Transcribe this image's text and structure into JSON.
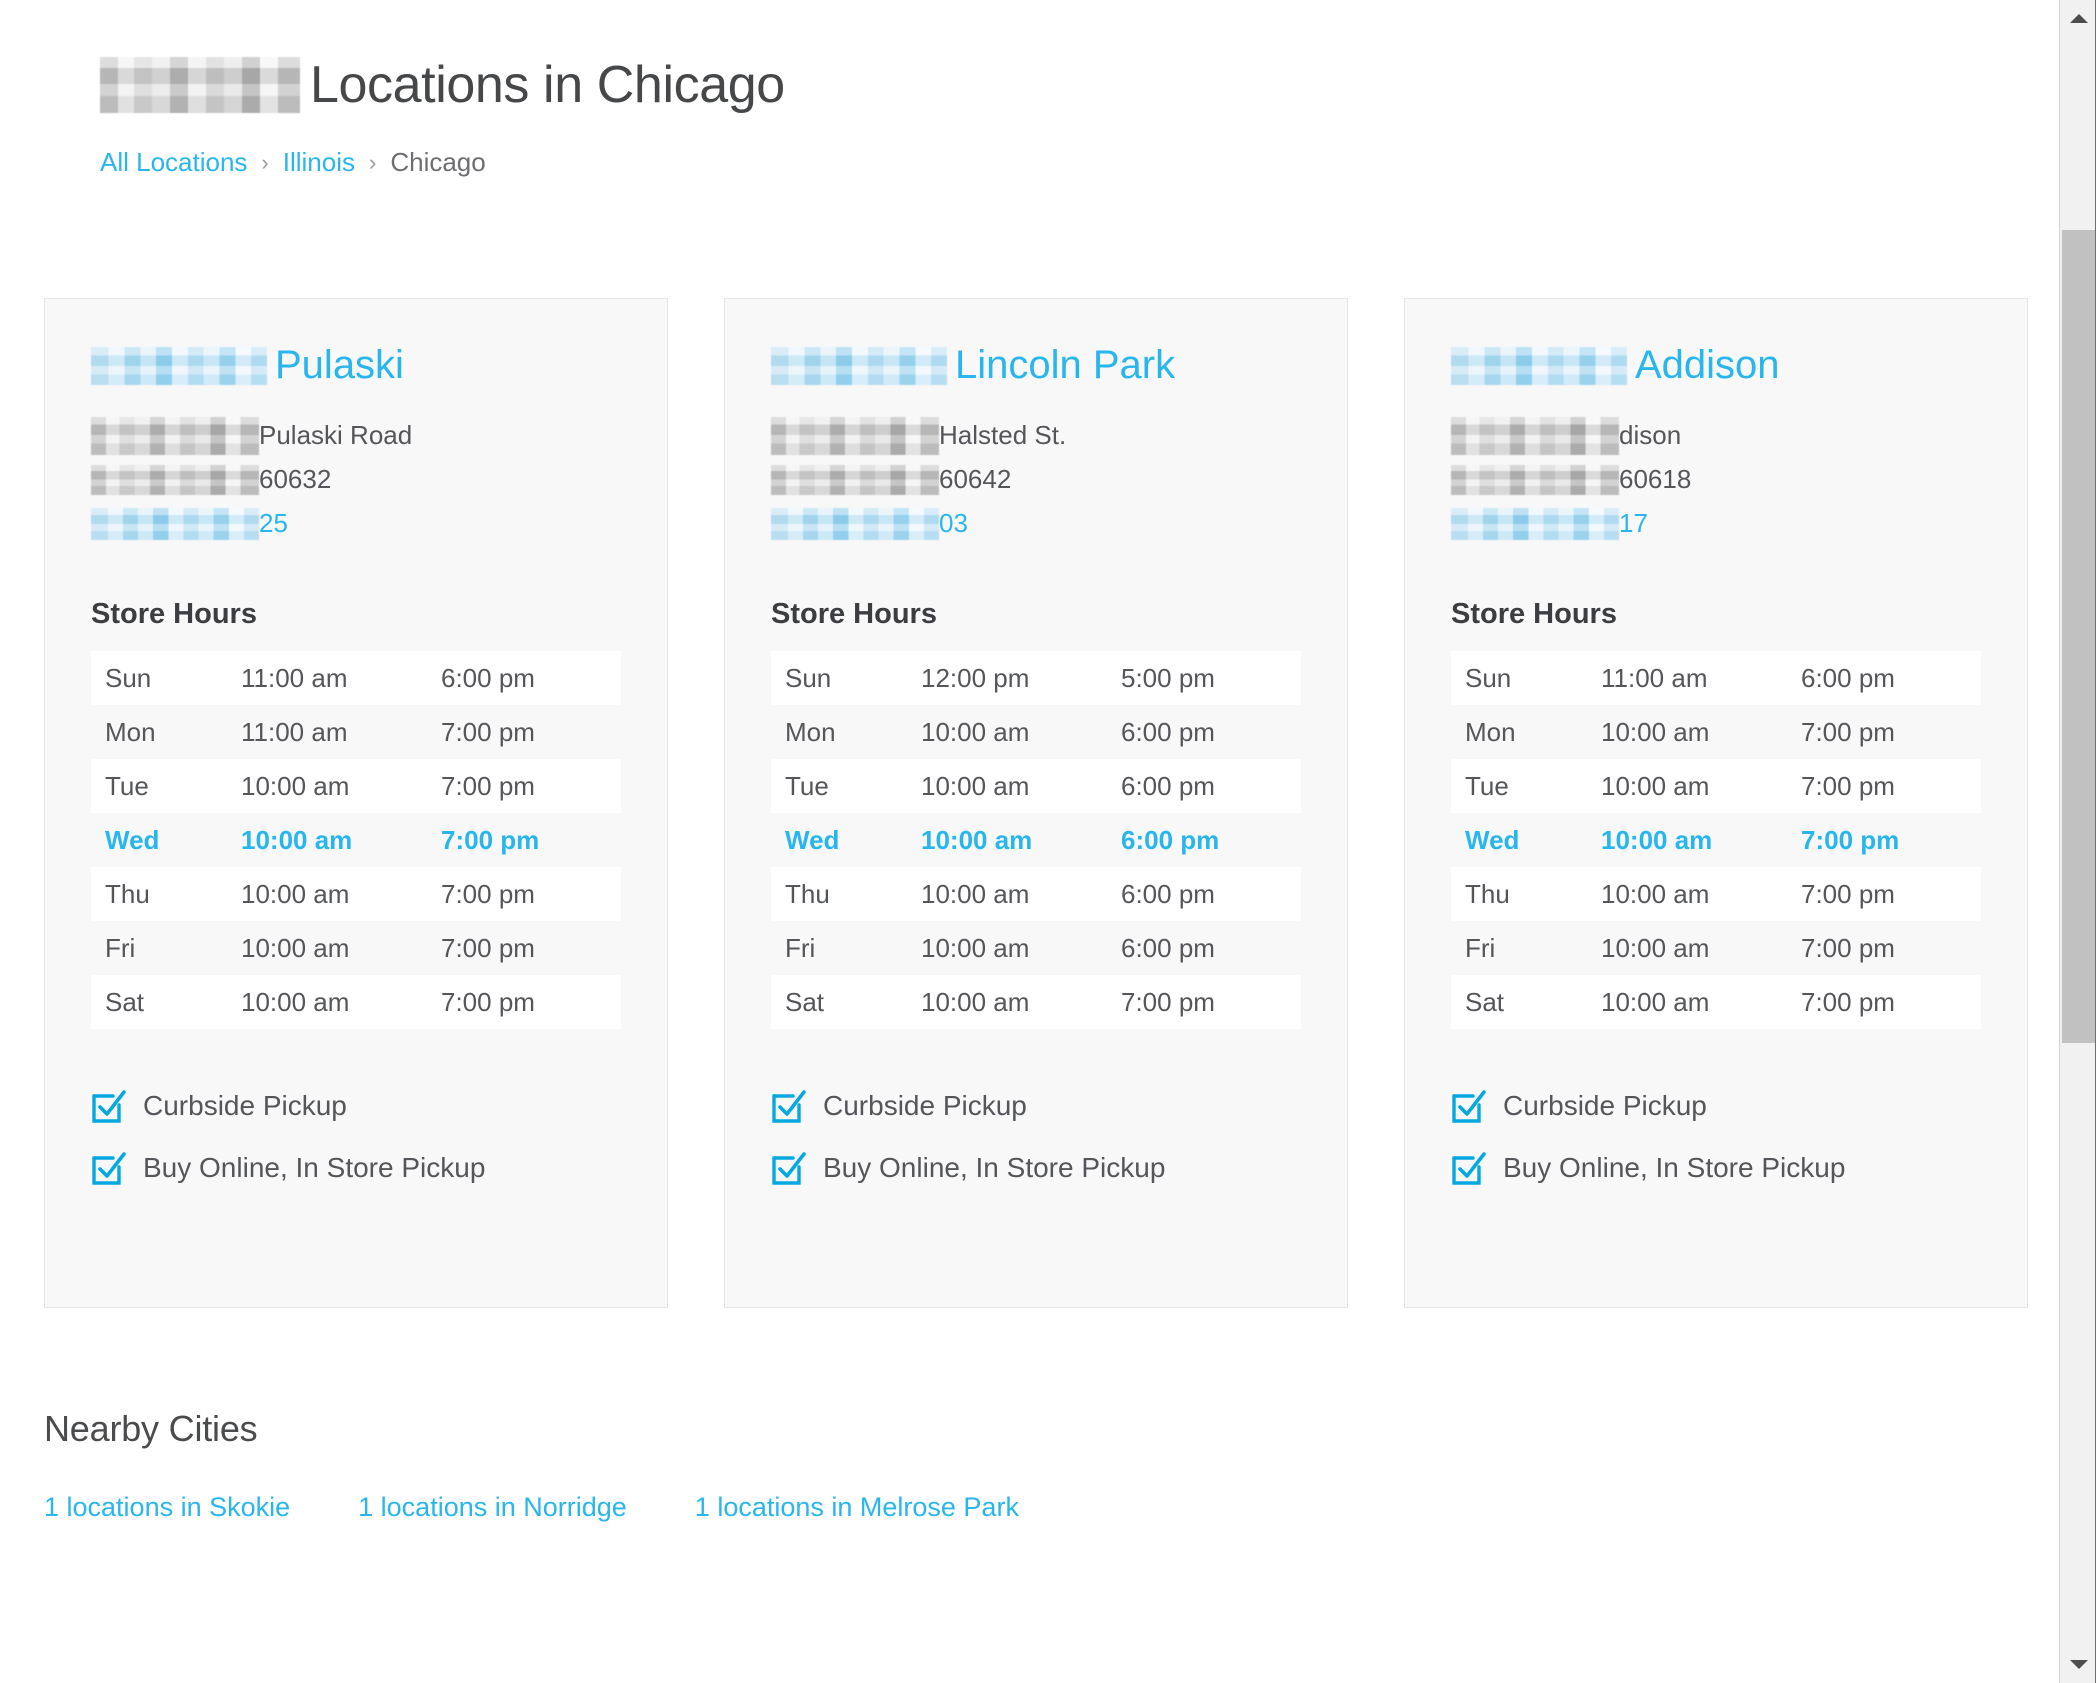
{
  "header": {
    "brand_redacted": "[redacted-brand]",
    "title": "Locations in Chicago"
  },
  "breadcrumb": {
    "separator": "›",
    "items": [
      {
        "label": "All Locations",
        "type": "link"
      },
      {
        "label": "Illinois",
        "type": "link"
      },
      {
        "label": "Chicago",
        "type": "current"
      }
    ]
  },
  "hours_days": [
    "Sun",
    "Mon",
    "Tue",
    "Wed",
    "Thu",
    "Fri",
    "Sat"
  ],
  "store_hours_heading": "Store Hours",
  "today": "Wed",
  "cards": [
    {
      "brand_redacted": "[redacted-brand]",
      "name": "Pulaski",
      "street_redacted": "[redacted]",
      "street": "Pulaski Road",
      "city_redacted": "[redacted]",
      "zip": "60632",
      "phone_redacted": "[redacted]",
      "phone_tail": "25",
      "hours": [
        {
          "day": "Sun",
          "open": "11:00 am",
          "close": "6:00 pm"
        },
        {
          "day": "Mon",
          "open": "11:00 am",
          "close": "7:00 pm"
        },
        {
          "day": "Tue",
          "open": "10:00 am",
          "close": "7:00 pm"
        },
        {
          "day": "Wed",
          "open": "10:00 am",
          "close": "7:00 pm"
        },
        {
          "day": "Thu",
          "open": "10:00 am",
          "close": "7:00 pm"
        },
        {
          "day": "Fri",
          "open": "10:00 am",
          "close": "7:00 pm"
        },
        {
          "day": "Sat",
          "open": "10:00 am",
          "close": "7:00 pm"
        }
      ],
      "services": [
        "Curbside Pickup",
        "Buy Online, In Store Pickup"
      ]
    },
    {
      "brand_redacted": "[redacted-brand]",
      "name": "Lincoln Park",
      "street_redacted": "[redacted]",
      "street": "Halsted St.",
      "city_redacted": "[redacted]",
      "zip": "60642",
      "phone_redacted": "[redacted]",
      "phone_tail": "03",
      "hours": [
        {
          "day": "Sun",
          "open": "12:00 pm",
          "close": "5:00 pm"
        },
        {
          "day": "Mon",
          "open": "10:00 am",
          "close": "6:00 pm"
        },
        {
          "day": "Tue",
          "open": "10:00 am",
          "close": "6:00 pm"
        },
        {
          "day": "Wed",
          "open": "10:00 am",
          "close": "6:00 pm"
        },
        {
          "day": "Thu",
          "open": "10:00 am",
          "close": "6:00 pm"
        },
        {
          "day": "Fri",
          "open": "10:00 am",
          "close": "6:00 pm"
        },
        {
          "day": "Sat",
          "open": "10:00 am",
          "close": "7:00 pm"
        }
      ],
      "services": [
        "Curbside Pickup",
        "Buy Online, In Store Pickup"
      ]
    },
    {
      "brand_redacted": "[redacted-brand]",
      "name": "Addison",
      "street_redacted": "[redacted]",
      "street": "dison",
      "city_redacted": "[redacted]",
      "zip": "60618",
      "phone_redacted": "[redacted]",
      "phone_tail": "17",
      "hours": [
        {
          "day": "Sun",
          "open": "11:00 am",
          "close": "6:00 pm"
        },
        {
          "day": "Mon",
          "open": "10:00 am",
          "close": "7:00 pm"
        },
        {
          "day": "Tue",
          "open": "10:00 am",
          "close": "7:00 pm"
        },
        {
          "day": "Wed",
          "open": "10:00 am",
          "close": "7:00 pm"
        },
        {
          "day": "Thu",
          "open": "10:00 am",
          "close": "7:00 pm"
        },
        {
          "day": "Fri",
          "open": "10:00 am",
          "close": "7:00 pm"
        },
        {
          "day": "Sat",
          "open": "10:00 am",
          "close": "7:00 pm"
        }
      ],
      "services": [
        "Curbside Pickup",
        "Buy Online, In Store Pickup"
      ]
    }
  ],
  "nearby": {
    "heading": "Nearby Cities",
    "links": [
      "1 locations in Skokie",
      "1 locations in Norridge",
      "1 locations in Melrose Park"
    ]
  },
  "colors": {
    "accent": "#29b6ed",
    "text": "#55565a",
    "heading": "#464749",
    "card_bg": "#f8f8f9",
    "card_border": "#e6e6e6",
    "row_alt": "#ffffff"
  }
}
